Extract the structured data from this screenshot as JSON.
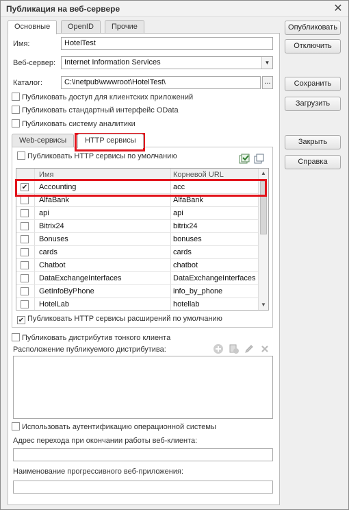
{
  "window": {
    "title": "Публикация на веб-сервере",
    "close_symbol": "✕"
  },
  "tabs": [
    "Основные",
    "OpenID",
    "Прочие"
  ],
  "fields": {
    "name_label": "Имя:",
    "name_value": "HotelTest",
    "server_label": "Веб-сервер:",
    "server_value": "Internet Information Services",
    "catalog_label": "Каталог:",
    "catalog_value": "C:\\inetpub\\wwwroot\\HotelTest\\",
    "catalog_button": "..."
  },
  "checks": {
    "client_apps": "Публиковать доступ для клиентских приложений",
    "odata": "Публиковать стандартный интерфейс OData",
    "analytics": "Публиковать систему аналитики"
  },
  "buttons": {
    "publish": "Опубликовать",
    "disable": "Отключить",
    "save": "Сохранить",
    "load": "Загрузить",
    "close": "Закрыть",
    "help": "Справка"
  },
  "subtabs": [
    "Web-сервисы",
    "HTTP сервисы"
  ],
  "http": {
    "default_label": "Публиковать HTTP сервисы по умолчанию",
    "columns": {
      "name": "Имя",
      "url": "Корневой URL"
    },
    "rows": [
      {
        "checked": true,
        "name": "Accounting",
        "url": "acc"
      },
      {
        "checked": false,
        "name": "AlfaBank",
        "url": "AlfaBank"
      },
      {
        "checked": false,
        "name": "api",
        "url": "api"
      },
      {
        "checked": false,
        "name": "Bitrix24",
        "url": "bitrix24"
      },
      {
        "checked": false,
        "name": "Bonuses",
        "url": "bonuses"
      },
      {
        "checked": false,
        "name": "cards",
        "url": "cards"
      },
      {
        "checked": false,
        "name": "Chatbot",
        "url": "chatbot"
      },
      {
        "checked": false,
        "name": "DataExchangeInterfaces",
        "url": "DataExchangeInterfaces"
      },
      {
        "checked": false,
        "name": "GetInfoByPhone",
        "url": "info_by_phone"
      },
      {
        "checked": false,
        "name": "HotelLab",
        "url": "hotellab"
      }
    ],
    "extensions_label": "Публиковать HTTP сервисы расширений по умолчанию"
  },
  "thin_client": {
    "publish_label": "Публиковать дистрибутив тонкого клиента",
    "location_label": "Расположение публикуемого дистрибутива:"
  },
  "os_auth_label": "Использовать аутентификацию операционной системы",
  "exit_url_label": "Адрес перехода при окончании работы веб-клиента:",
  "pwa_label": "Наименование прогрессивного веб-приложения:",
  "colors": {
    "highlight": "#e2141c",
    "accent_green": "#3a8f3a"
  }
}
